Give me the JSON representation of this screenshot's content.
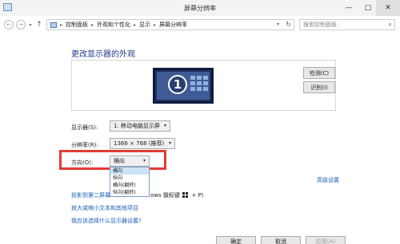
{
  "window": {
    "title": "屏幕分辨率",
    "min_glyph": "—",
    "max_glyph": "□",
    "close_glyph": "✕"
  },
  "address": {
    "back_glyph": "←",
    "forward_glyph": "→",
    "dropdown_glyph": "▾",
    "up_glyph": "↑",
    "breadcrumbs": [
      "控制面板",
      "外观和个性化",
      "显示",
      "屏幕分辨率"
    ],
    "sep": "▸",
    "refresh_glyph": "↻",
    "search_placeholder": "搜索控制面板",
    "search_glyph": "⌕"
  },
  "page": {
    "heading": "更改显示器的外观"
  },
  "preview": {
    "monitor_number": "1",
    "detect_label": "检测(C)",
    "identify_label": "识别(I)"
  },
  "settings": {
    "display_label": "显示器(S):",
    "display_value": "1. 移动电脑显示屏",
    "resolution_label": "分辨率(R):",
    "resolution_value": "1366 × 768 (推荐)",
    "orientation_label": "方向(O):",
    "orientation_value": "横向",
    "arrow_glyph": "▾",
    "orientation_options": [
      "横向",
      "纵向",
      "横向(翻转)",
      "纵向(翻转)"
    ]
  },
  "links": {
    "advanced": "高级设置",
    "project_start": "投影到第二屏幕",
    "project_end": "ows 徽标键",
    "project_key": "+ P)",
    "enlarge": "放大或缩小文本和其他项目",
    "which": "我应该选择什么显示器设置?"
  },
  "buttons": {
    "ok": "确定",
    "cancel": "取消",
    "apply": "应用(A)"
  }
}
